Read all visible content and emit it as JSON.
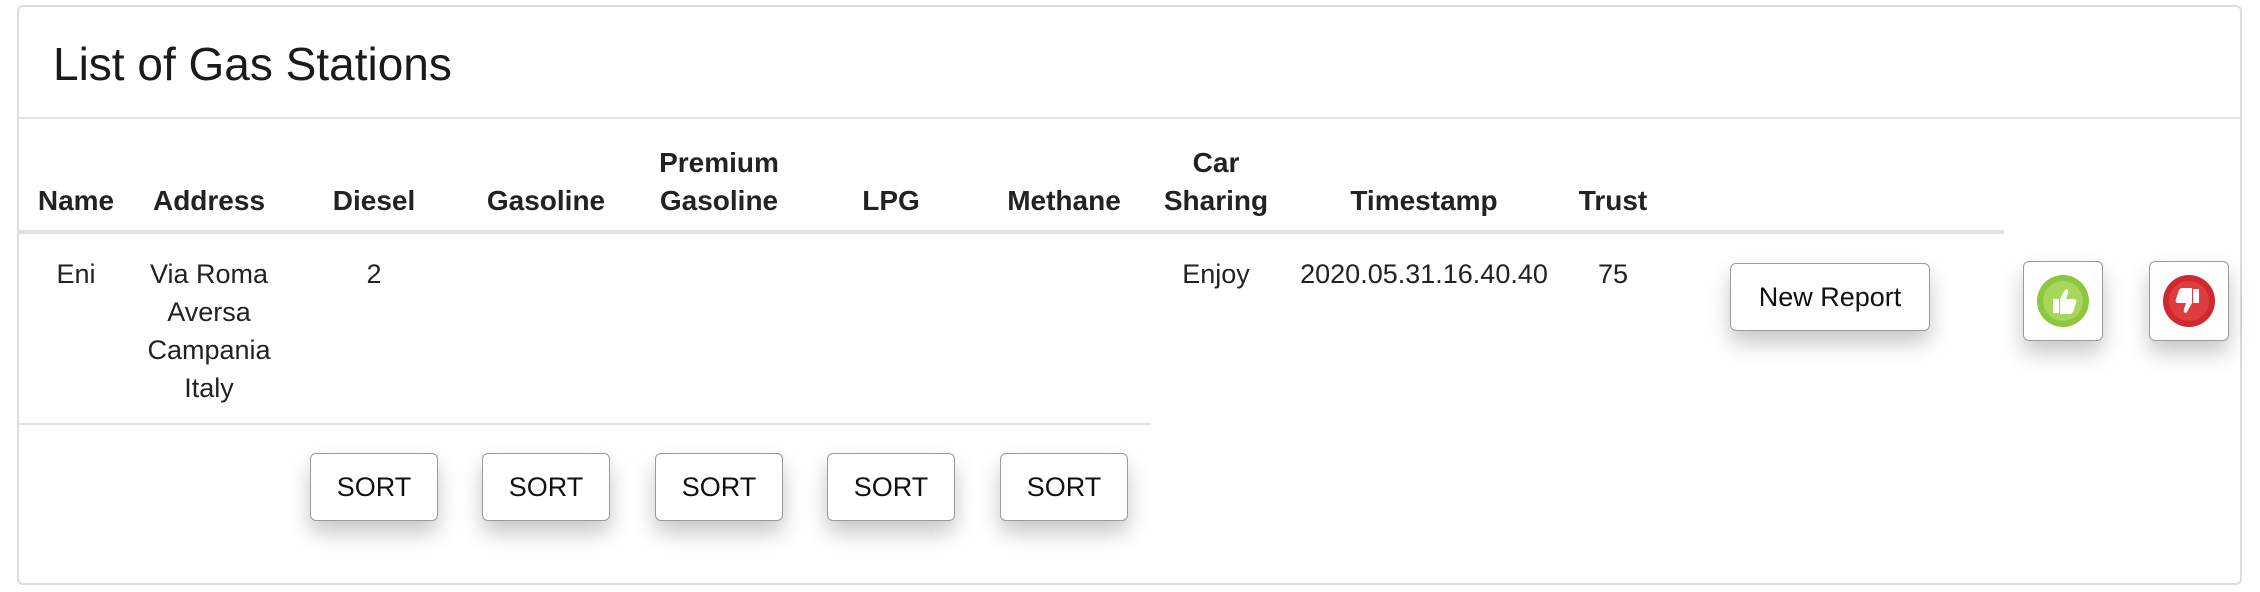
{
  "title": "List of Gas Stations",
  "columns": {
    "name": "Name",
    "address": "Address",
    "diesel": "Diesel",
    "gasoline": "Gasoline",
    "premium_line1": "Premium",
    "premium_line2": "Gasoline",
    "lpg": "LPG",
    "methane": "Methane",
    "car_line1": "Car",
    "car_line2": "Sharing",
    "timestamp": "Timestamp",
    "trust": "Trust"
  },
  "rows": [
    {
      "name": "Eni",
      "address_lines": [
        "Via Roma",
        "Aversa",
        "Campania",
        "Italy"
      ],
      "diesel": "2",
      "gasoline": "",
      "premium": "",
      "lpg": "",
      "methane": "",
      "car_sharing": "Enjoy",
      "timestamp": "2020.05.31.16.40.40",
      "trust": "75",
      "report_label": "New Report"
    }
  ],
  "sort_label": "SORT",
  "icons": {
    "upvote": "thumbs-up-icon",
    "downvote": "thumbs-down-icon"
  },
  "colors": {
    "upvote": "#8dc63f",
    "downvote": "#d0282e"
  }
}
